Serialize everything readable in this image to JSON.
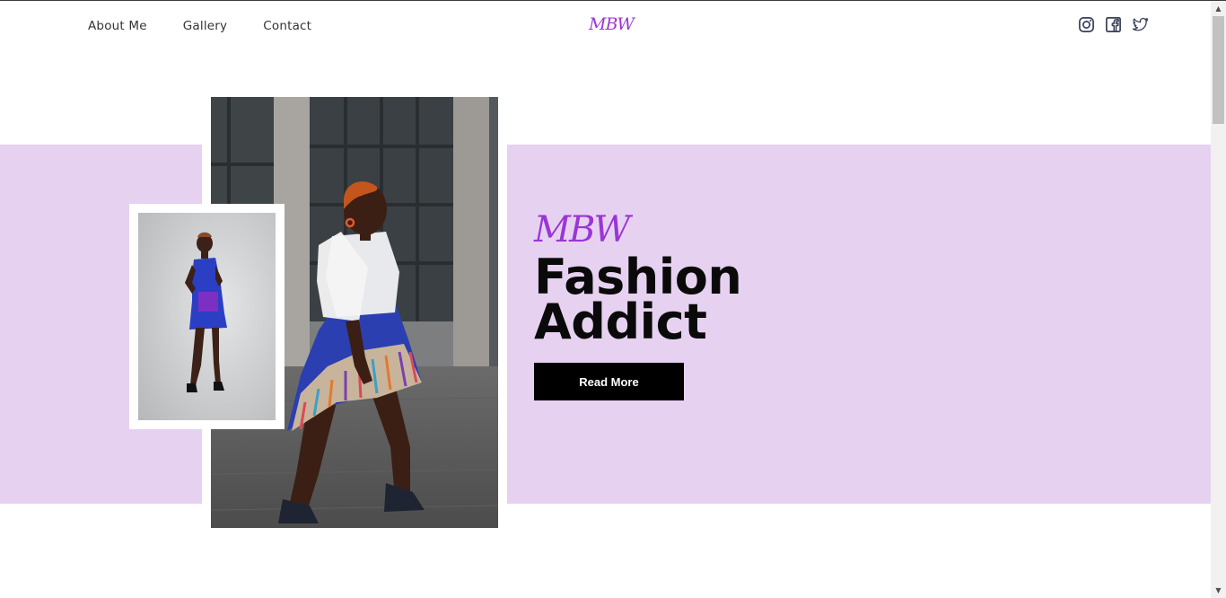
{
  "header": {
    "nav": [
      {
        "label": "About Me"
      },
      {
        "label": "Gallery"
      },
      {
        "label": "Contact"
      }
    ],
    "logo": "MBW",
    "social_icons": [
      "instagram-icon",
      "facebook-icon",
      "twitter-icon"
    ]
  },
  "hero": {
    "logo": "MBW",
    "title_line1": "Fashion",
    "title_line2": "Addict",
    "button_label": "Read More"
  },
  "colors": {
    "accent": "#9b35d6",
    "band": "#e6d2f0",
    "button": "#000000",
    "icon": "#3b3f5c"
  }
}
